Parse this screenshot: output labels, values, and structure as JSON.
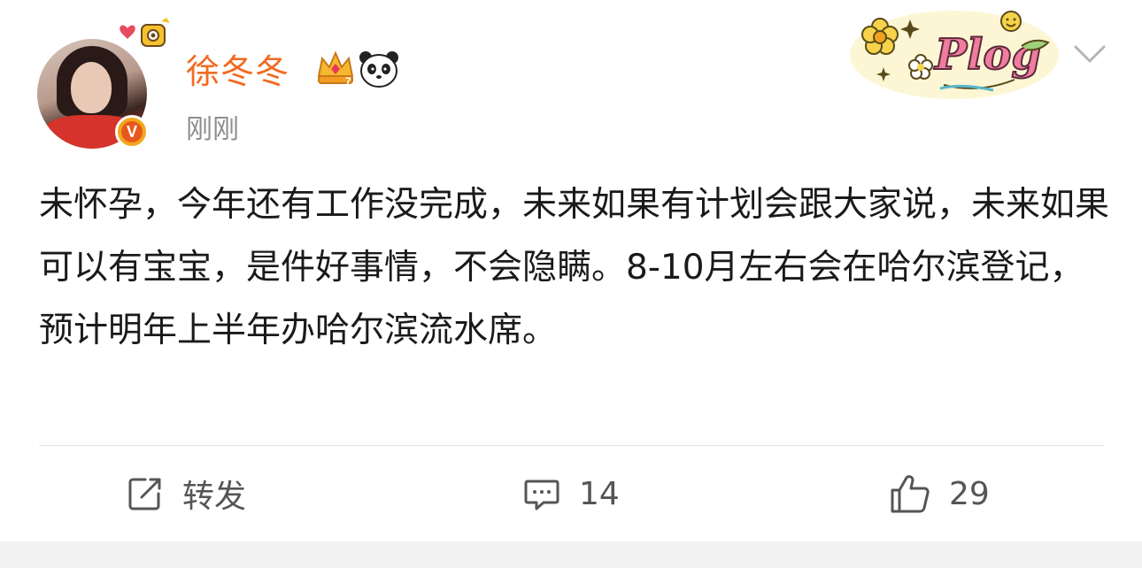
{
  "post": {
    "author": "徐冬冬",
    "time": "刚刚",
    "verified_mark": "V",
    "badge_text": "Plog",
    "content": "未怀孕，今年还有工作没完成，未来如果有计划会跟大家说，未来如果可以有宝宝，是件好事情，不会隐瞒。8-10月左右会在哈尔滨登记，预计明年上半年办哈尔滨流水席。"
  },
  "actions": {
    "repost_label": "转发",
    "comment_count": "14",
    "like_count": "29"
  },
  "colors": {
    "author": "#f26a1f",
    "time": "#8e8e8e",
    "text": "#1a1a1a",
    "action": "#555555"
  },
  "icons": [
    "verified-icon",
    "crown-icon",
    "panda-icon",
    "plog-badge-icon",
    "chevron-down-icon",
    "repost-icon",
    "comment-icon",
    "like-icon"
  ]
}
